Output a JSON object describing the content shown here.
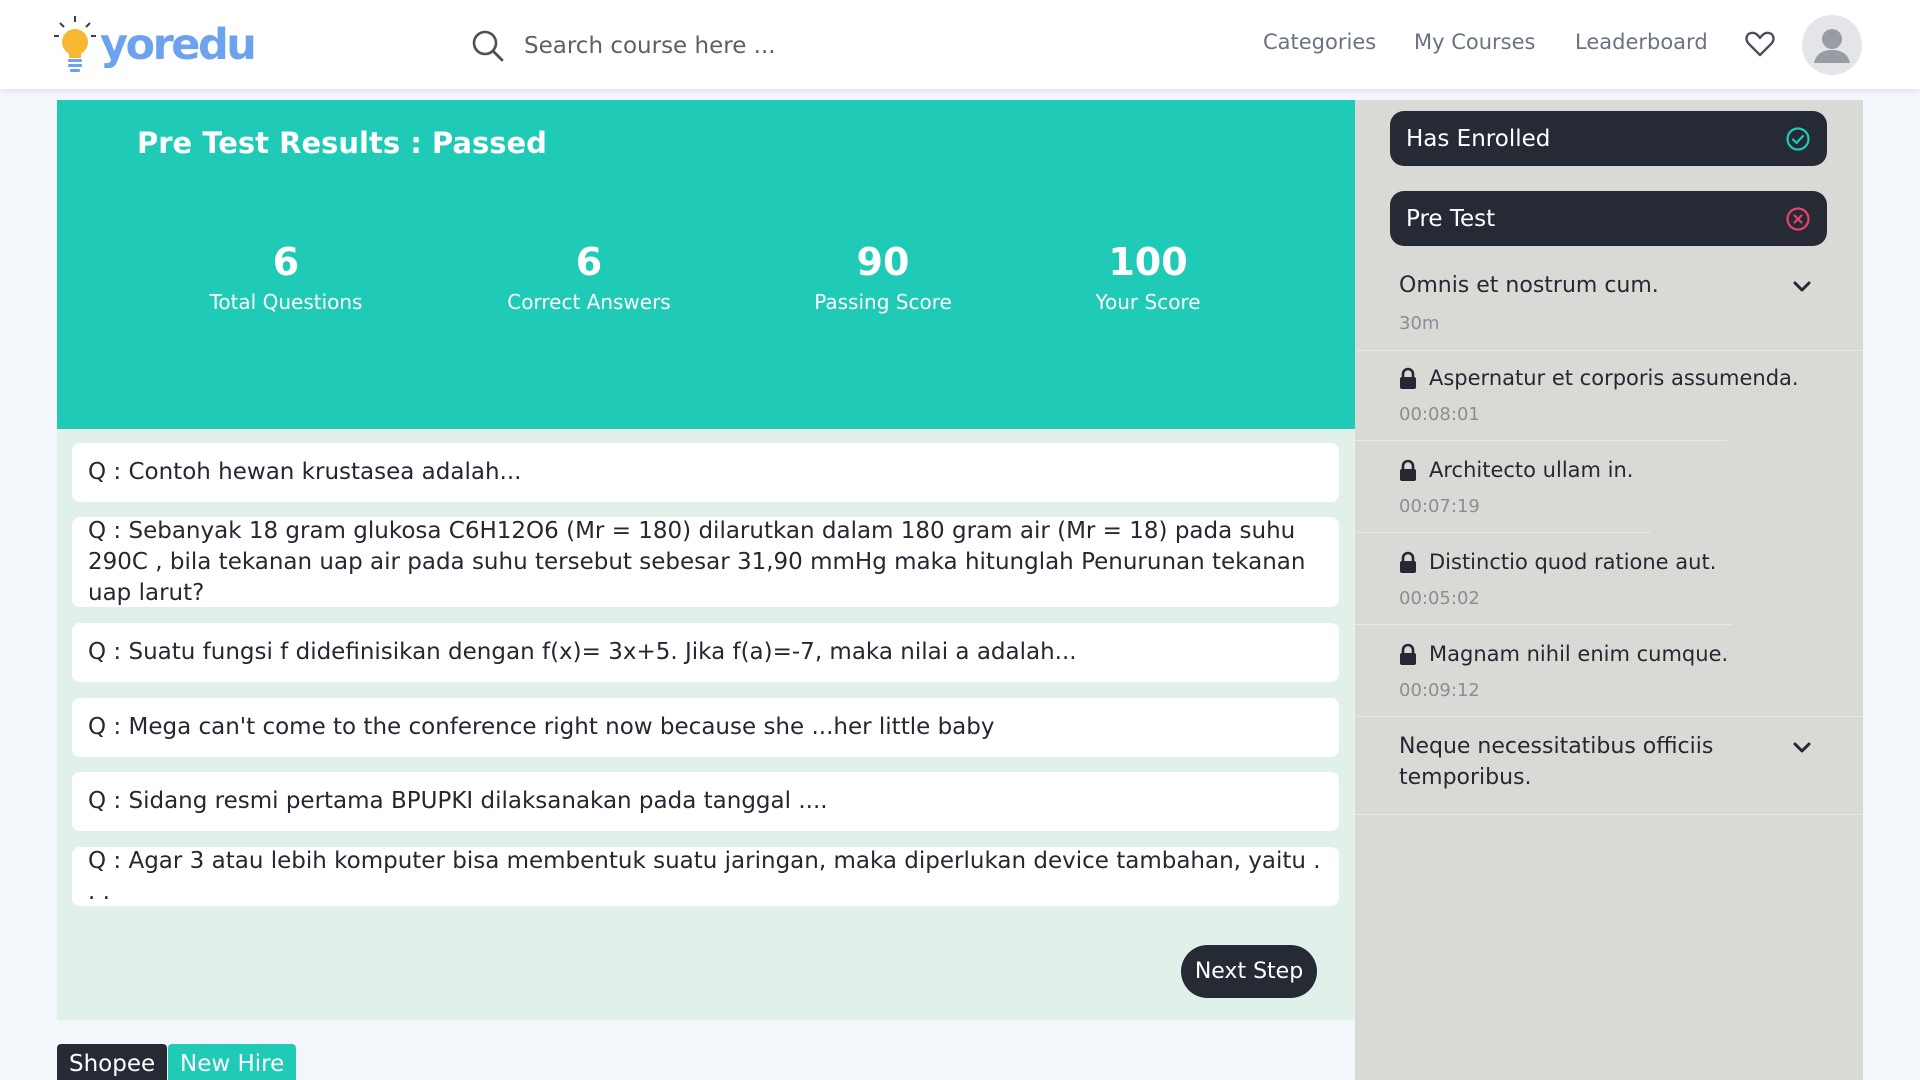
{
  "brand": {
    "name": "yoredu",
    "bulb_color": "#f7b731",
    "text_color": "#6da3ee"
  },
  "search": {
    "placeholder": "Search course here ..."
  },
  "nav": {
    "categories": "Categories",
    "my_courses": "My Courses",
    "leaderboard": "Leaderboard"
  },
  "hero": {
    "title": "Pre Test Results : Passed",
    "stats": [
      {
        "value": "6",
        "label": "Total Questions"
      },
      {
        "value": "6",
        "label": "Correct Answers"
      },
      {
        "value": "90",
        "label": "Passing Score"
      },
      {
        "value": "100",
        "label": "Your Score"
      }
    ]
  },
  "questions": [
    "Q : Contoh hewan krustasea adalah...",
    "Q : Sebanyak 18 gram glukosa C6H12O6 (Mr = 180) dilarutkan dalam 180 gram air (Mr = 18) pada suhu 290C , bila tekanan uap air pada suhu tersebut sebesar 31,90 mmHg maka hitunglah Penurunan tekanan uap larut?",
    "Q : Suatu fungsi f didefinisikan dengan f(x)= 3x+5. Jika f(a)=-7, maka nilai a adalah...",
    "Q : Mega can't come to the conference right now because she ...her little baby",
    "Q : Sidang resmi pertama BPUPKI dilaksanakan pada tanggal ....",
    "Q : Agar 3 atau lebih komputer bisa membentuk suatu jaringan, maka diperlukan device tambahan, yaitu . . ."
  ],
  "next_button": "Next Step",
  "tags": [
    "Shopee",
    "New Hire"
  ],
  "sidebar": {
    "enrolled": "Has Enrolled",
    "pretest": "Pre Test",
    "section1": {
      "title": "Omnis et nostrum cum.",
      "duration": "30m"
    },
    "lessons": [
      {
        "title": "Aspernatur et corporis assumenda.",
        "time": "00:08:01"
      },
      {
        "title": "Architecto ullam in.",
        "time": "00:07:19"
      },
      {
        "title": "Distinctio quod ratione aut.",
        "time": "00:05:02"
      },
      {
        "title": "Magnam nihil enim cumque.",
        "time": "00:09:12"
      }
    ],
    "section2": {
      "title": "Neque necessitatibus officiis temporibus."
    }
  },
  "colors": {
    "teal": "#1fcbb7",
    "dark": "#252a35",
    "success": "#1fcbb7",
    "fail": "#e8436a"
  }
}
